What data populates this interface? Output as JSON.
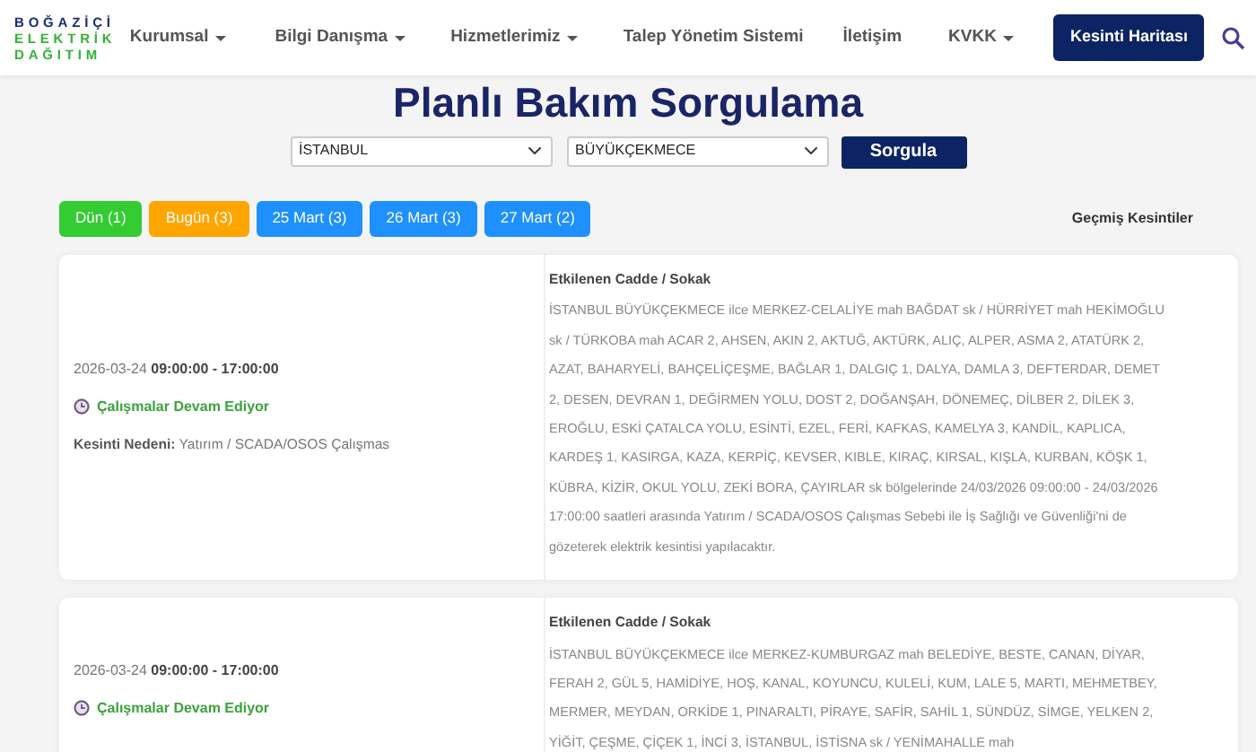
{
  "logo": {
    "lines": [
      "BOĞAZİÇİ",
      "ELEKTRİK",
      "DAĞITIM"
    ]
  },
  "nav": {
    "items": [
      {
        "label": "Kurumsal",
        "dropdown": true
      },
      {
        "label": "Bilgi Danışma",
        "dropdown": true
      },
      {
        "label": "Hizmetlerimiz",
        "dropdown": true
      },
      {
        "label": "Talep Yönetim Sistemi",
        "dropdown": false
      },
      {
        "label": "İletişim",
        "dropdown": false
      },
      {
        "label": "KVKK",
        "dropdown": true
      }
    ],
    "button": "Kesinti Haritası"
  },
  "title": "Planlı Bakım Sorgulama",
  "query": {
    "city": "İSTANBUL",
    "district": "BÜYÜKÇEKMECE",
    "button": "Sorgula"
  },
  "days": [
    {
      "label": "Dün (1)",
      "color": "#33cc33"
    },
    {
      "label": "Bugün (3)",
      "color": "#ffa500"
    },
    {
      "label": "25 Mart (3)",
      "color": "#1e90ff"
    },
    {
      "label": "26 Mart (3)",
      "color": "#1e90ff"
    },
    {
      "label": "27 Mart (2)",
      "color": "#1e90ff"
    }
  ],
  "history_link": "Geçmiş Kesintiler",
  "outages": [
    {
      "date": "2026-03-24",
      "time": "09:00:00 - 17:00:00",
      "status": "Çalışmalar Devam Ediyor",
      "reason_label": "Kesinti Nedeni:",
      "reason": "Yatırım / SCADA/OSOS Çalışmas",
      "streets_heading": "Etkilenen Cadde / Sokak",
      "streets": "İSTANBUL BÜYÜKÇEKMECE ilce MERKEZ-CELALİYE mah BAĞDAT sk / HÜRRİYET mah HEKİMOĞLU sk / TÜRKOBA mah ACAR 2, AHSEN, AKIN 2, AKTUĞ, AKTÜRK, ALIÇ, ALPER, ASMA 2, ATATÜRK 2, AZAT, BAHARYELİ, BAHÇELİÇEŞME, BAĞLAR 1, DALGIÇ 1, DALYA, DAMLA 3, DEFTERDAR, DEMET 2, DESEN, DEVRAN 1, DEĞİRMEN YOLU, DOST 2, DOĞANŞAH, DÖNEMEÇ, DİLBER 2, DİLEK 3, EROĞLU, ESKİ ÇATALCA YOLU, ESİNTİ, EZEL, FERİ, KAFKAS, KAMELYA 3, KANDİL, KAPLICA, KARDEŞ 1, KASIRGA, KAZA, KERPİÇ, KEVSER, KIBLE, KIRAÇ, KIRSAL, KIŞLA, KURBAN, KÖŞK 1, KÜBRA, KİZİR, OKUL YOLU, ZEKİ BORA, ÇAYIRLAR sk bölgelerinde 24/03/2026 09:00:00 - 24/03/2026 17:00:00 saatleri arasında Yatırım / SCADA/OSOS Çalışmas Sebebi ile İş Sağlığı ve Güvenliği'ni de gözeterek elektrik kesintisi yapılacaktır."
    },
    {
      "date": "2026-03-24",
      "time": "09:00:00 - 17:00:00",
      "status": "Çalışmalar Devam Ediyor",
      "streets_heading": "Etkilenen Cadde / Sokak",
      "streets": "İSTANBUL BÜYÜKÇEKMECE ilce MERKEZ-KUMBURGAZ mah BELEDİYE, BESTE, CANAN, DİYAR, FERAH 2, GÜL 5, HAMİDİYE, HOŞ, KANAL, KOYUNCU, KULELİ, KUM, LALE 5, MARTI, MEHMETBEY, MERMER, MEYDAN, ORKİDE 1, PINARALTI, PİRAYE, SAFİR, SAHİL 1, SÜNDÜZ, SİMGE, YELKEN 2, YİĞİT, ÇEŞME, ÇİÇEK 1, İNCİ 3, İSTANBUL, İSTİSNA sk / YENİMAHALLE mah"
    }
  ]
}
